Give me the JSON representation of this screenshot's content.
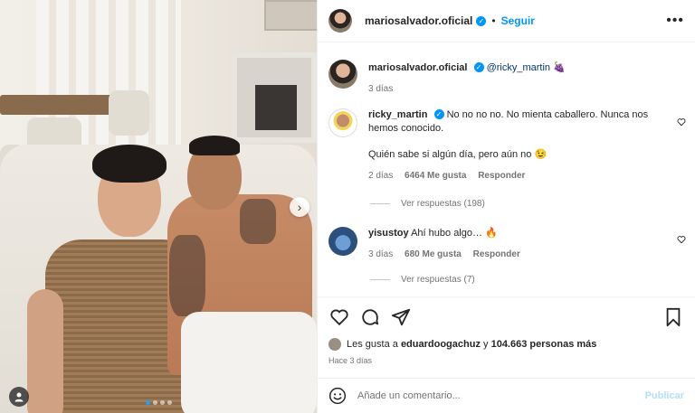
{
  "header": {
    "username": "mariosalvador.oficial",
    "separator": "•",
    "follow_label": "Seguir",
    "more_icon": "more-horizontal-icon"
  },
  "caption": {
    "username": "mariosalvador.oficial",
    "mention": "@ricky_martin",
    "emoji": "🍇",
    "time": "3 días"
  },
  "comments": [
    {
      "username": "ricky_martin",
      "text": "No no no no. No mienta caballero. Nunca nos hemos conocido.",
      "text2": "Quién sabe si algún día, pero aún no 😉",
      "time": "2 días",
      "likes": "6464 Me gusta",
      "reply": "Responder",
      "view_replies": "Ver respuestas (198)"
    },
    {
      "username": "yisustoy",
      "text": "Ahí hubo algo… 🔥",
      "time": "3 días",
      "likes": "680 Me gusta",
      "reply": "Responder",
      "view_replies": "Ver respuestas (7)"
    }
  ],
  "likes_line": {
    "prefix": "Les gusta a",
    "user": "eduardoogachuz",
    "middle": "y",
    "count": "104.663 personas más"
  },
  "post_time": "Hace 3 días",
  "add_comment": {
    "placeholder": "Añade un comentario...",
    "publish": "Publicar"
  },
  "colors": {
    "accent": "#0095f6",
    "publish_disabled": "#b2dffc",
    "muted": "#737373"
  },
  "carousel": {
    "active_index": 0,
    "count": 4
  }
}
